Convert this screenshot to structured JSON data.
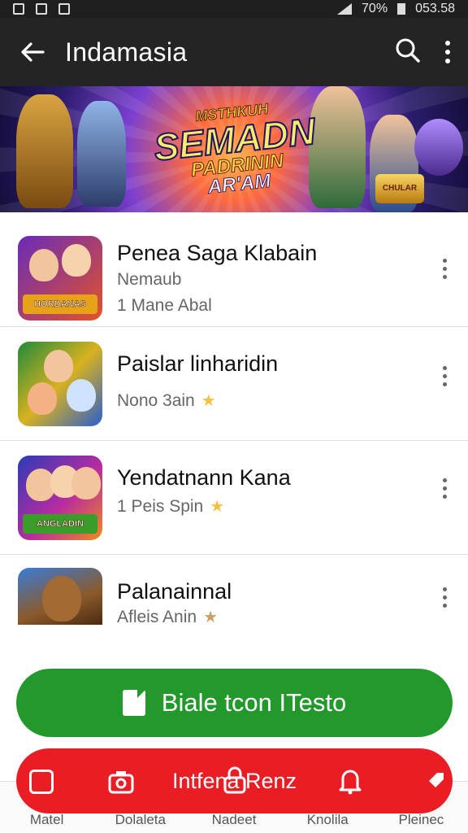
{
  "status_bar": {
    "battery": "70%",
    "time": "053.58"
  },
  "app_bar": {
    "title": "Indamasia",
    "back_icon": "arrow-left-icon",
    "search_icon": "search-icon",
    "more_icon": "more-vertical-icon"
  },
  "banner": {
    "logo_line1": "MSTHKUH",
    "logo_line2": "SEMADN",
    "logo_line3": "PADRININ",
    "logo_line4": "AR'AM",
    "crest_text": "CHULAR"
  },
  "games": [
    {
      "name": "Penea Saga Klabain",
      "line1": "Nemaub",
      "line2": "1 Mane Abal",
      "thumb_caption": "HORDANAS",
      "star": false
    },
    {
      "name": "Paislar linharidin",
      "line1": "Nono 3ain",
      "star": true
    },
    {
      "name": "Yendatnann Kana",
      "line1": "1 Peis Spin",
      "thumb_caption": "ANGLADIN",
      "star": true
    },
    {
      "name": "Palanainnal",
      "line1": "Afleis Anin",
      "star": true
    }
  ],
  "primary_button": {
    "label": "Biale tcon ITesto",
    "icon": "document-icon"
  },
  "secondary_button": {
    "label": "Intfena Renz"
  },
  "bottom_nav": [
    {
      "label": "Matel"
    },
    {
      "label": "Dolaleta"
    },
    {
      "label": "Nadeet"
    },
    {
      "label": "Knolila"
    },
    {
      "label": "Pleinec"
    }
  ],
  "colors": {
    "green": "#23992c",
    "red": "#ea1c24",
    "app_bar": "#242424",
    "star": "#f6c143"
  }
}
